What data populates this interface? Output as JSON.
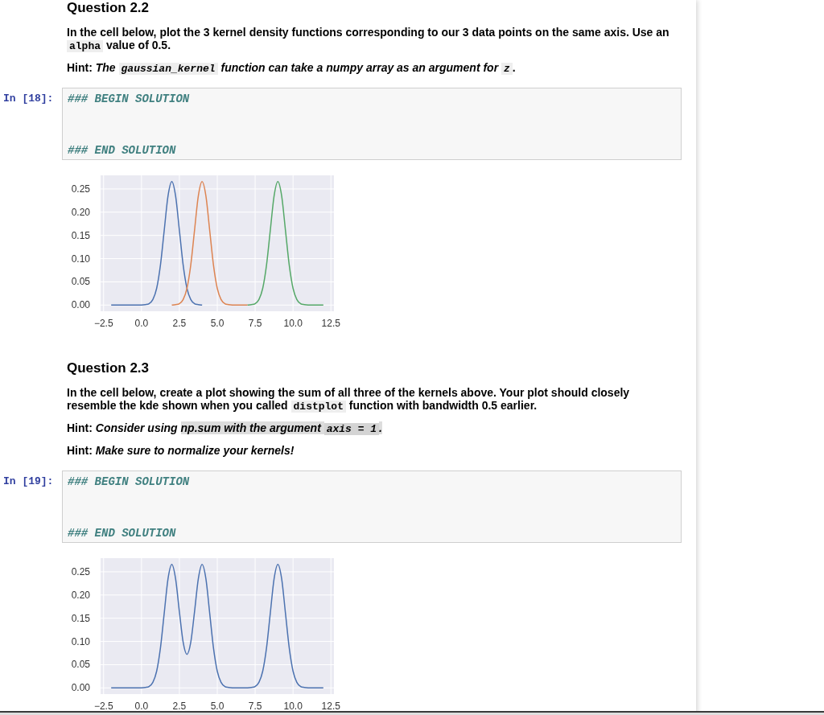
{
  "cells": [
    {
      "kind": "markdown",
      "heading": "Question 2.2",
      "paragraphs": [
        [
          {
            "kind": "text",
            "text": "In the cell below, plot the 3 kernel density functions corresponding to our 3 data points on the same axis. Use an "
          },
          {
            "kind": "code",
            "text": "alpha"
          },
          {
            "kind": "text",
            "text": " value of 0.5."
          }
        ],
        [
          {
            "kind": "text",
            "text": "Hint: "
          },
          {
            "kind": "em",
            "text": "The "
          },
          {
            "kind": "em_code",
            "text": "gaussian_kernel"
          },
          {
            "kind": "em",
            "text": " function can take a numpy array as an argument for "
          },
          {
            "kind": "em_code",
            "text": "z"
          },
          {
            "kind": "text",
            "text": "."
          }
        ]
      ]
    },
    {
      "kind": "code",
      "prompt": "In [18]:",
      "lines": [
        "### BEGIN SOLUTION",
        "### END SOLUTION"
      ],
      "chart_data": {
        "type": "line",
        "grid": true,
        "x": [
          -2,
          -1.75,
          -1.5,
          -1.25,
          -1,
          -0.75,
          -0.5,
          -0.25,
          0,
          0.25,
          0.5,
          0.75,
          1,
          1.25,
          1.5,
          1.75,
          2,
          2.25,
          2.5,
          2.75,
          3,
          3.25,
          3.5,
          3.75,
          4,
          4.25,
          4.5,
          4.75,
          5,
          5.25,
          5.5,
          5.75,
          6,
          6.25,
          6.5,
          6.75,
          7,
          7.25,
          7.5,
          7.75,
          8,
          8.25,
          8.5,
          8.75,
          9,
          9.25,
          9.5,
          9.75,
          10,
          10.25,
          10.5,
          10.75,
          11,
          11.25,
          11.5,
          11.75,
          12
        ],
        "series": [
          {
            "color": "#4c72b0",
            "values": [
              0,
              0,
              0,
              0,
              0,
              0,
              0,
              0,
              0,
              0.001,
              0.003,
              0.012,
              0.036,
              0.086,
              0.161,
              0.235,
              0.266,
              0.235,
              0.161,
              0.086,
              0.036,
              0.012,
              0.003,
              0.001,
              0,
              null,
              null,
              null,
              null,
              null,
              null,
              null,
              null,
              null,
              null,
              null,
              null,
              null,
              null,
              null,
              null,
              null,
              null,
              null,
              null,
              null,
              null,
              null,
              null,
              null,
              null,
              null,
              null,
              null,
              null,
              null,
              null
            ]
          },
          {
            "color": "#dd8452",
            "values": [
              null,
              null,
              null,
              null,
              null,
              null,
              null,
              null,
              null,
              null,
              null,
              null,
              null,
              null,
              null,
              null,
              0,
              0.001,
              0.003,
              0.012,
              0.036,
              0.086,
              0.161,
              0.235,
              0.266,
              0.235,
              0.161,
              0.086,
              0.036,
              0.012,
              0.003,
              0.001,
              0,
              0,
              0,
              0,
              0,
              null,
              null,
              null,
              null,
              null,
              null,
              null,
              null,
              null,
              null,
              null,
              null,
              null,
              null,
              null,
              null,
              null,
              null,
              null,
              null
            ]
          },
          {
            "color": "#55a868",
            "values": [
              null,
              null,
              null,
              null,
              null,
              null,
              null,
              null,
              null,
              null,
              null,
              null,
              null,
              null,
              null,
              null,
              null,
              null,
              null,
              null,
              null,
              null,
              null,
              null,
              null,
              null,
              null,
              null,
              null,
              null,
              null,
              null,
              null,
              null,
              null,
              null,
              0,
              0.001,
              0.003,
              0.012,
              0.036,
              0.086,
              0.161,
              0.235,
              0.266,
              0.235,
              0.161,
              0.086,
              0.036,
              0.012,
              0.003,
              0.001,
              0,
              0,
              0,
              0,
              0
            ]
          }
        ],
        "xlim": [
          -2.7,
          12.7
        ],
        "ylim": [
          -0.0133,
          0.2793
        ],
        "xticks": [
          {
            "value": -2.5,
            "label": "−2.5"
          },
          {
            "value": 0,
            "label": "0.0"
          },
          {
            "value": 2.5,
            "label": "2.5"
          },
          {
            "value": 5,
            "label": "5.0"
          },
          {
            "value": 7.5,
            "label": "7.5"
          },
          {
            "value": 10,
            "label": "10.0"
          },
          {
            "value": 12.5,
            "label": "12.5"
          }
        ],
        "yticks": [
          {
            "value": 0,
            "label": "0.00"
          },
          {
            "value": 0.05,
            "label": "0.05"
          },
          {
            "value": 0.1,
            "label": "0.10"
          },
          {
            "value": 0.15,
            "label": "0.15"
          },
          {
            "value": 0.2,
            "label": "0.20"
          },
          {
            "value": 0.25,
            "label": "0.25"
          }
        ]
      }
    },
    {
      "kind": "markdown",
      "heading": "Question 2.3",
      "paragraphs": [
        [
          {
            "kind": "text",
            "text": "In the cell below, create a plot showing the sum of all three of the kernels above. Your plot should closely resemble the kde shown when you called "
          },
          {
            "kind": "code",
            "text": "distplot"
          },
          {
            "kind": "text",
            "text": " function with bandwidth 0.5 earlier."
          }
        ],
        [
          {
            "kind": "text",
            "text": "Hint: "
          },
          {
            "kind": "em",
            "text": "Consider using "
          },
          {
            "kind": "mark",
            "text": "np.sum with the argument "
          },
          {
            "kind": "mark_code",
            "text": "axis = 1"
          },
          {
            "kind": "mark",
            "text": "."
          }
        ],
        [
          {
            "kind": "text",
            "text": "Hint: "
          },
          {
            "kind": "em",
            "text": "Make sure to normalize your kernels!"
          }
        ]
      ]
    },
    {
      "kind": "code",
      "prompt": "In [19]:",
      "lines": [
        "### BEGIN SOLUTION",
        "### END SOLUTION"
      ],
      "chart_data": {
        "type": "line",
        "grid": true,
        "x": [
          -2,
          -1.75,
          -1.5,
          -1.25,
          -1,
          -0.75,
          -0.5,
          -0.25,
          0,
          0.25,
          0.5,
          0.75,
          1,
          1.25,
          1.5,
          1.75,
          2,
          2.25,
          2.5,
          2.75,
          3,
          3.25,
          3.5,
          3.75,
          4,
          4.25,
          4.5,
          4.75,
          5,
          5.25,
          5.5,
          5.75,
          6,
          6.25,
          6.5,
          6.75,
          7,
          7.25,
          7.5,
          7.75,
          8,
          8.25,
          8.5,
          8.75,
          9,
          9.25,
          9.5,
          9.75,
          10,
          10.25,
          10.5,
          10.75,
          11,
          11.25,
          11.5,
          11.75,
          12
        ],
        "series": [
          {
            "color": "#4c72b0",
            "values": [
              0,
              0,
              0,
              0,
              0,
              0,
              0,
              0,
              0,
              0.001,
              0.003,
              0.012,
              0.036,
              0.086,
              0.161,
              0.235,
              0.266,
              0.235,
              0.164,
              0.098,
              0.072,
              0.098,
              0.164,
              0.235,
              0.266,
              0.235,
              0.161,
              0.086,
              0.036,
              0.012,
              0.003,
              0.001,
              0,
              0,
              0,
              0,
              0,
              0.001,
              0.003,
              0.012,
              0.036,
              0.086,
              0.161,
              0.235,
              0.266,
              0.235,
              0.161,
              0.086,
              0.036,
              0.012,
              0.003,
              0.001,
              0,
              0,
              0,
              0,
              0
            ]
          }
        ],
        "xlim": [
          -2.7,
          12.7
        ],
        "ylim": [
          -0.0133,
          0.2793
        ],
        "xticks": [
          {
            "value": -2.5,
            "label": "−2.5"
          },
          {
            "value": 0,
            "label": "0.0"
          },
          {
            "value": 2.5,
            "label": "2.5"
          },
          {
            "value": 5,
            "label": "5.0"
          },
          {
            "value": 7.5,
            "label": "7.5"
          },
          {
            "value": 10,
            "label": "10.0"
          },
          {
            "value": 12.5,
            "label": "12.5"
          }
        ],
        "yticks": [
          {
            "value": 0,
            "label": "0.00"
          },
          {
            "value": 0.05,
            "label": "0.05"
          },
          {
            "value": 0.1,
            "label": "0.10"
          },
          {
            "value": 0.15,
            "label": "0.15"
          },
          {
            "value": 0.2,
            "label": "0.20"
          },
          {
            "value": 0.25,
            "label": "0.25"
          }
        ]
      }
    }
  ]
}
